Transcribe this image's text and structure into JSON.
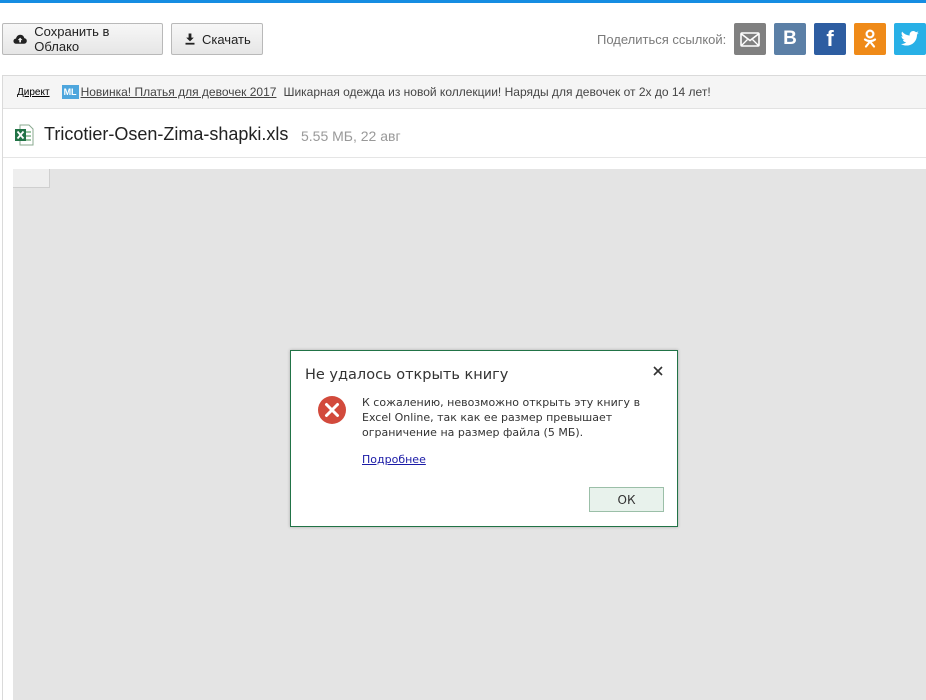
{
  "toolbar": {
    "save_label": "Сохранить в Облако",
    "download_label": "Скачать",
    "share_label": "Поделиться ссылкой:",
    "social": {
      "vk_letter": "В",
      "fb_letter": "f"
    }
  },
  "ad": {
    "direct_label": "Директ",
    "badge": "ML",
    "link_text": "Новинка! Платья для девочек 2017",
    "description": "Шикарная одежда из новой коллекции! Наряды для девочек от 2х до 14 лет!"
  },
  "file": {
    "name": "Tricotier-Osen-Zima-shapki.xls",
    "meta": "5.55 МБ, 22 авг"
  },
  "dialog": {
    "title": "Не удалось открыть книгу",
    "message": "К сожалению, невозможно открыть эту книгу в Excel Online, так как ее размер превышает ограничение на размер файла (5 МБ).",
    "more_link": "Подробнее",
    "ok_label": "ОК"
  },
  "colors": {
    "top_stripe": "#168de2",
    "dialog_border": "#217346",
    "error_red": "#d24a3c",
    "viewer_bg": "#e4e4e4"
  }
}
